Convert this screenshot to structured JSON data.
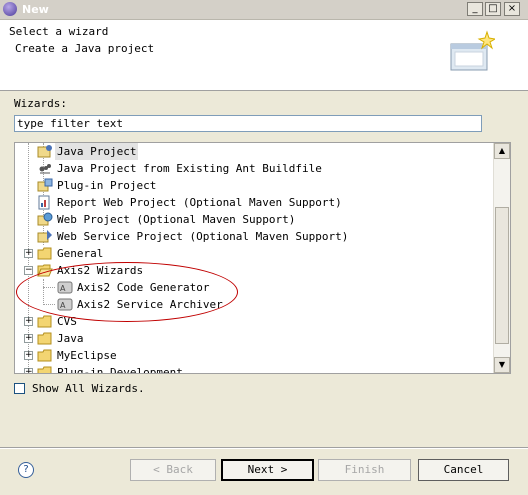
{
  "window": {
    "title": "New",
    "minimize": "_",
    "maximize": "□",
    "close": "×"
  },
  "header": {
    "title": "Select a wizard",
    "description": "Create a Java project"
  },
  "wizards_label": "Wizards:",
  "filter": {
    "value": "type filter text"
  },
  "tree": {
    "items": [
      {
        "label": "Java Project",
        "icon": "java-project-icon"
      },
      {
        "label": "Java Project from Existing Ant Buildfile",
        "icon": "ant-icon"
      },
      {
        "label": "Plug-in Project",
        "icon": "plugin-project-icon"
      },
      {
        "label": "Report Web Project (Optional Maven Support)",
        "icon": "report-project-icon"
      },
      {
        "label": "Web Project (Optional Maven Support)",
        "icon": "web-project-icon"
      },
      {
        "label": "Web Service Project (Optional Maven Support)",
        "icon": "web-service-icon"
      },
      {
        "label": "General",
        "icon": "folder-icon"
      },
      {
        "label": "Axis2 Wizards",
        "icon": "folder-open-icon"
      },
      {
        "label": "Axis2 Code Generator",
        "icon": "axis2-icon"
      },
      {
        "label": "Axis2 Service Archiver",
        "icon": "axis2-icon"
      },
      {
        "label": "CVS",
        "icon": "folder-icon"
      },
      {
        "label": "Java",
        "icon": "folder-icon"
      },
      {
        "label": "MyEclipse",
        "icon": "folder-icon"
      },
      {
        "label": "Plug-in Development",
        "icon": "folder-icon"
      }
    ]
  },
  "show_all": {
    "label": "Show All Wizards.",
    "checked": false
  },
  "buttons": {
    "help": "?",
    "back": "< Back",
    "next": "Next >",
    "finish": "Finish",
    "cancel": "Cancel"
  },
  "colors": {
    "annotation": "#c00000",
    "selection": "#e3e3e3",
    "dialog_bg": "#ece9d8"
  }
}
